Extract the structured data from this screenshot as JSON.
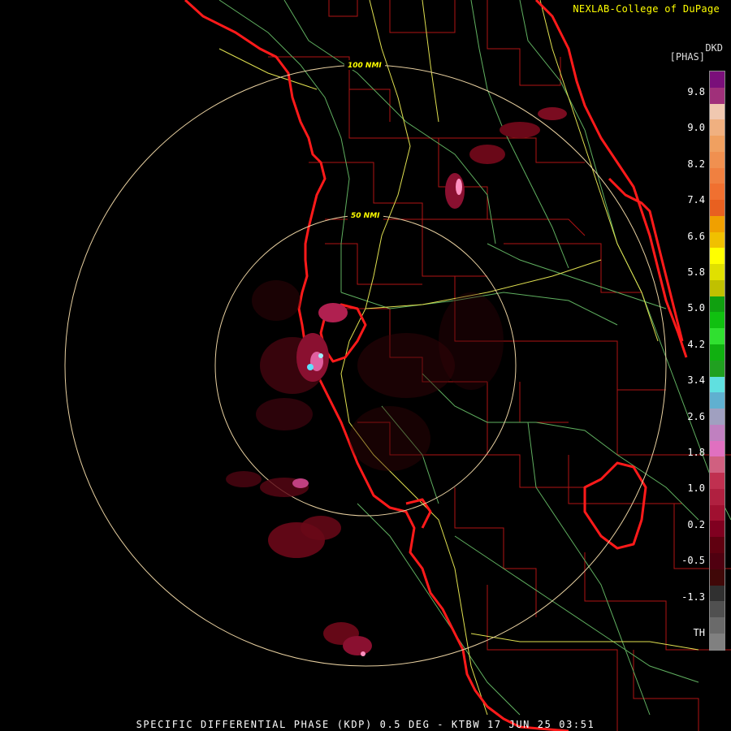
{
  "credit": "NEXLAB-College of DuPage",
  "legend": {
    "unit_code": "DKD",
    "unit_label": "[PHAS]",
    "ticks": [
      "9.8",
      "9.0",
      "8.2",
      "7.4",
      "6.6",
      "5.8",
      "5.0",
      "4.2",
      "3.4",
      "2.6",
      "1.8",
      "1.0",
      "0.2",
      "-0.5",
      "-1.3",
      "TH"
    ],
    "colors": [
      "#7a0f7a",
      "#a0307a",
      "#f0c8b0",
      "#f0b080",
      "#f0a060",
      "#f09050",
      "#f08040",
      "#f07030",
      "#e86020",
      "#f0a000",
      "#f0c000",
      "#ffff00",
      "#e0e000",
      "#c0c000",
      "#10a010",
      "#10c010",
      "#30e030",
      "#10b010",
      "#20a020",
      "#60e0e0",
      "#60b0d0",
      "#a0a0c0",
      "#c080c0",
      "#e070c0",
      "#d06080",
      "#c03050",
      "#b02040",
      "#a01030",
      "#800020",
      "#600010",
      "#500010",
      "#400808",
      "#303030",
      "#505050",
      "#6a6a6a",
      "#808080"
    ]
  },
  "rings": [
    {
      "label": "100 NMI"
    },
    {
      "label": "50 NMI"
    }
  ],
  "footer": "SPECIFIC DIFFERENTIAL PHASE (KDP) 0.5 DEG - KTBW 17 JUN 25 03:51",
  "colors": {
    "coast": "#ff2020",
    "county": "#c01818",
    "highway": "#e8e860",
    "road": "#70c070",
    "ring": "#e8d0a0",
    "echo_dark": "#6a0818",
    "echo_mid": "#a0204a",
    "echo_light": "#ff80c0",
    "echo_peak": "#60e0ff"
  }
}
